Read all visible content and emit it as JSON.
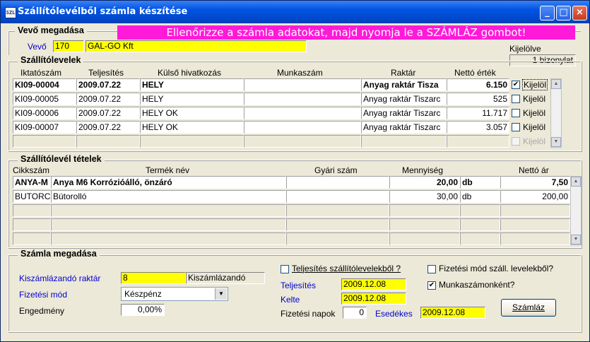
{
  "window": {
    "title": "Szállítólevélből számla készítése",
    "icon_text": "SZL"
  },
  "vevo_section": {
    "group_label": "Vevő megadása",
    "banner": "Ellenőrizze a számla adatokat, majd nyomja le a SZÁMLÁZ gombot!",
    "vevo_label": "Vevő",
    "vevo_code": "170",
    "vevo_name": "GAL-GO Kft",
    "kijelolve_label": "Kijelölve",
    "kijelolve_value": "1 bizonylat"
  },
  "szallitolevelek": {
    "group_label": "Szállítólevelek",
    "columns": [
      "Iktatószám",
      "Teljesítés",
      "Külső hivatkozás",
      "Munkaszám",
      "Raktár",
      "Nettó érték"
    ],
    "rows": [
      {
        "iktato": "KI09-00004",
        "teljesites": "2009.07.22",
        "kulso": "HELY",
        "munkaszam": "",
        "raktar": "Anyag raktár Tisza",
        "netto": "6.150",
        "checked": true,
        "check_label": "Kijelöl",
        "bold": true
      },
      {
        "iktato": "KI09-00005",
        "teljesites": "2009.07.22",
        "kulso": "HELY",
        "munkaszam": "",
        "raktar": "Anyag raktár Tiszarc",
        "netto": "525",
        "checked": false,
        "check_label": "Kijelöl",
        "bold": false
      },
      {
        "iktato": "KI09-00006",
        "teljesites": "2009.07.22",
        "kulso": "HELY OK",
        "munkaszam": "",
        "raktar": "Anyag raktár Tiszarc",
        "netto": "11.717",
        "checked": false,
        "check_label": "Kijelöl",
        "bold": false
      },
      {
        "iktato": "KI09-00007",
        "teljesites": "2009.07.22",
        "kulso": "HELY OK",
        "munkaszam": "",
        "raktar": "Anyag raktár Tiszarc",
        "netto": "3.057",
        "checked": false,
        "check_label": "Kijelöl",
        "bold": false
      },
      {
        "iktato": "",
        "teljesites": "",
        "kulso": "",
        "munkaszam": "",
        "raktar": "",
        "netto": "",
        "checked": false,
        "check_label": "Kijelöl",
        "bold": false,
        "disabled": true
      }
    ]
  },
  "tetelek": {
    "group_label": "Szállítólevél tételek",
    "columns": [
      "Cikkszám",
      "Termék név",
      "Gyári szám",
      "Mennyiség",
      "Nettó ár"
    ],
    "rows": [
      {
        "cikkszam": "ANYA-M",
        "nev": "Anya M6 Korrózióálló, önzáró",
        "gyari": "",
        "menny": "20,00",
        "me": "db",
        "ar": "7,50",
        "bold": true
      },
      {
        "cikkszam": "BUTORC",
        "nev": "Bútorolló",
        "gyari": "",
        "menny": "30,00",
        "me": "db",
        "ar": "200,00",
        "bold": false
      },
      {
        "cikkszam": "",
        "nev": "",
        "gyari": "",
        "menny": "",
        "me": "",
        "ar": "",
        "bold": false
      },
      {
        "cikkszam": "",
        "nev": "",
        "gyari": "",
        "menny": "",
        "me": "",
        "ar": "",
        "bold": false
      },
      {
        "cikkszam": "",
        "nev": "",
        "gyari": "",
        "menny": "",
        "me": "",
        "ar": "",
        "bold": false
      }
    ]
  },
  "szamla": {
    "group_label": "Számla megadása",
    "raktar_label": "Kiszámlázandó raktár",
    "raktar_code": "8",
    "raktar_name": "Kiszámlázandó",
    "fizmod_label": "Fizetési mód",
    "fizmod_value": "Készpénz",
    "engedmeny_label": "Engedmény",
    "engedmeny_value": "0,00%",
    "telj_szall_label": "Teljesítés szállítólevelekből ?",
    "telj_szall_checked": false,
    "fizmod_szall_label": "Fizetési mód száll. levelekből?",
    "fizmod_szall_checked": false,
    "munkaszam_label": "Munkaszámonként?",
    "munkaszam_checked": true,
    "teljesites_label": "Teljesítés",
    "teljesites_value": "2009.12.08",
    "kelte_label": "Kelte",
    "kelte_value": "2009.12.08",
    "fiz_napok_label": "Fizetési napok",
    "fiz_napok_value": "0",
    "esedekes_label": "Esedékes",
    "esedekes_value": "2009.12.08",
    "szamlaz_button": "Számláz"
  },
  "colors": {
    "title_bar": "#0054e3",
    "banner": "#ff19d8",
    "field_highlight": "#ffff00",
    "label_blue": "#0000d0"
  }
}
